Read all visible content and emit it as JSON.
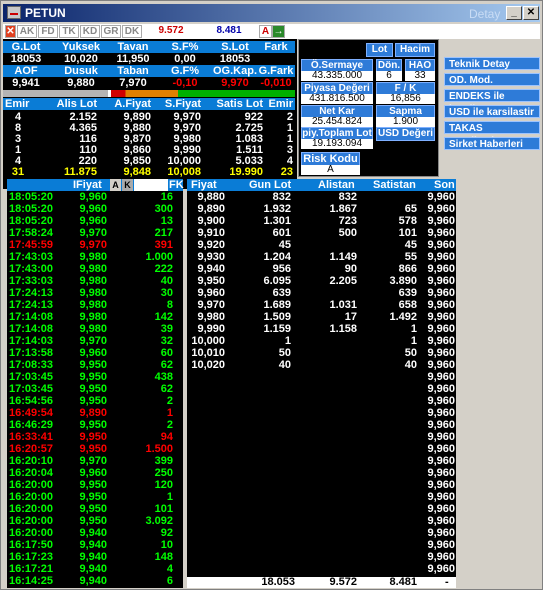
{
  "window": {
    "title": "PETUN",
    "title_faded": "Detay",
    "min": "_",
    "max": "□",
    "close": "✕"
  },
  "toolbar": {
    "buttons": [
      "AK",
      "FD",
      "TK",
      "KD",
      "GR",
      "DK"
    ],
    "price1": "9.572",
    "price2": "8.481",
    "a_label": "A",
    "go_label": "→"
  },
  "summary": {
    "row1_headers": [
      "G.Lot",
      "Yuksek",
      "Tavan",
      "S.F%",
      "S.Lot",
      "Fark"
    ],
    "row1_values": [
      "18053",
      "10,020",
      "11,950",
      "0,00",
      "18053",
      ""
    ],
    "row2_headers": [
      "AOF",
      "Dusuk",
      "Taban",
      "G.F%",
      "OG.Kap.",
      "G.Fark"
    ],
    "row2_values": [
      "9,941",
      "9,880",
      "7,970",
      "-0,10",
      "9,970",
      "-0,010"
    ]
  },
  "depth": {
    "headers": [
      "Emir",
      "Alis Lot",
      "A.Fiyat",
      "S.Fiyat",
      "Satis Lot",
      "Emir"
    ],
    "rows": [
      [
        "4",
        "2.152",
        "9,890",
        "9,970",
        "922",
        "2"
      ],
      [
        "8",
        "4.365",
        "9,880",
        "9,970",
        "2.725",
        "1"
      ],
      [
        "3",
        "116",
        "9,870",
        "9,980",
        "1.083",
        "1"
      ],
      [
        "1",
        "110",
        "9,860",
        "9,990",
        "1.511",
        "3"
      ],
      [
        "4",
        "220",
        "9,850",
        "10,000",
        "5.033",
        "4"
      ]
    ],
    "totals": [
      "31",
      "11.875",
      "9,848",
      "10,008",
      "19.990",
      "23"
    ]
  },
  "panel": {
    "lot": "Lot",
    "hacim": "Hacim",
    "o_sermaye": "Ö.Sermaye",
    "o_sermaye_val": "43.335.000",
    "don": "Dön.",
    "don_val": "6",
    "hao": "HAO",
    "hao_val": "33",
    "piyasa": "Piyasa Değeri",
    "piyasa_val": "431.816.500",
    "fk": "F / K",
    "fk_val": "16,856",
    "net_kar": "Net Kar",
    "net_kar_val": "25.454.824",
    "sapma": "Sapma",
    "sapma_val": "1.900",
    "toplam_lot": "piy.Toplam Lot",
    "toplam_lot_val": "19.193.094",
    "usd": "USD Değeri",
    "risk": "Risk Kodu",
    "risk_val": "A"
  },
  "menu": [
    "Teknik Detay",
    "OD. Mod.",
    "ENDEKS ile karsilas",
    "USD ile karsilastir",
    "TAKAS Karsilastirm",
    "Sirket Haberleri"
  ],
  "trades": {
    "header_fiyat": "IFiyat",
    "btn_a": "A",
    "btn_k": "K",
    "btn_fk": "FK",
    "rows": [
      [
        "18:05:20",
        "9,960",
        "16",
        "w"
      ],
      [
        "18:05:20",
        "9,960",
        "300",
        "w"
      ],
      [
        "18:05:20",
        "9,960",
        "13",
        "w"
      ],
      [
        "17:58:24",
        "9,970",
        "217",
        "w"
      ],
      [
        "17:45:59",
        "9,970",
        "391",
        "r"
      ],
      [
        "17:43:03",
        "9,980",
        "1.000",
        "w"
      ],
      [
        "17:43:00",
        "9,980",
        "222",
        "w"
      ],
      [
        "17:33:03",
        "9,980",
        "40",
        "w"
      ],
      [
        "17:24:13",
        "9,980",
        "30",
        "w"
      ],
      [
        "17:24:13",
        "9,980",
        "8",
        "w"
      ],
      [
        "17:14:08",
        "9,980",
        "142",
        "w"
      ],
      [
        "17:14:08",
        "9,980",
        "39",
        "w"
      ],
      [
        "17:14:03",
        "9,970",
        "32",
        "w"
      ],
      [
        "17:13:58",
        "9,960",
        "60",
        "w"
      ],
      [
        "17:08:33",
        "9,950",
        "62",
        "w"
      ],
      [
        "17:03:45",
        "9,950",
        "438",
        "w"
      ],
      [
        "17:03:45",
        "9,950",
        "62",
        "w"
      ],
      [
        "16:54:56",
        "9,950",
        "2",
        "w"
      ],
      [
        "16:49:54",
        "9,890",
        "1",
        "r"
      ],
      [
        "16:46:29",
        "9,950",
        "2",
        "w"
      ],
      [
        "16:33:41",
        "9,950",
        "94",
        "r"
      ],
      [
        "16:20:57",
        "9,950",
        "1.500",
        "r"
      ],
      [
        "16:20:10",
        "9,970",
        "399",
        "w"
      ],
      [
        "16:20:04",
        "9,960",
        "250",
        "w"
      ],
      [
        "16:20:00",
        "9,950",
        "120",
        "w"
      ],
      [
        "16:20:00",
        "9,950",
        "1",
        "w"
      ],
      [
        "16:20:00",
        "9,950",
        "101",
        "w"
      ],
      [
        "16:20:00",
        "9,950",
        "3.092",
        "w"
      ],
      [
        "16:20:00",
        "9,940",
        "92",
        "w"
      ],
      [
        "16:17:50",
        "9,940",
        "10",
        "w"
      ],
      [
        "16:17:23",
        "9,940",
        "148",
        "w"
      ],
      [
        "16:17:21",
        "9,940",
        "4",
        "w"
      ],
      [
        "16:14:25",
        "9,940",
        "6",
        "w"
      ]
    ]
  },
  "levels": {
    "headers": [
      "Fiyat",
      "Gun Lot",
      "Alistan",
      "Satistan",
      "Son"
    ],
    "rows": [
      [
        "9,880",
        "832",
        "832",
        "",
        "9,960"
      ],
      [
        "9,890",
        "1.932",
        "1.867",
        "65",
        "9,960"
      ],
      [
        "9,900",
        "1.301",
        "723",
        "578",
        "9,960"
      ],
      [
        "9,910",
        "601",
        "500",
        "101",
        "9,960"
      ],
      [
        "9,920",
        "45",
        "",
        "45",
        "9,960"
      ],
      [
        "9,930",
        "1.204",
        "1.149",
        "55",
        "9,960"
      ],
      [
        "9,940",
        "956",
        "90",
        "866",
        "9,960"
      ],
      [
        "9,950",
        "6.095",
        "2.205",
        "3.890",
        "9,960"
      ],
      [
        "9,960",
        "639",
        "",
        "639",
        "9,960"
      ],
      [
        "9,970",
        "1.689",
        "1.031",
        "658",
        "9,960"
      ],
      [
        "9,980",
        "1.509",
        "17",
        "1.492",
        "9,960"
      ],
      [
        "9,990",
        "1.159",
        "1.158",
        "1",
        "9,960"
      ],
      [
        "10,000",
        "1",
        "",
        "1",
        "9,960"
      ],
      [
        "10,010",
        "50",
        "",
        "50",
        "9,960"
      ],
      [
        "10,020",
        "40",
        "",
        "40",
        "9,960"
      ]
    ],
    "son_tail": [
      "9,960",
      "9,960",
      "9,960",
      "9,960",
      "9,960",
      "9,960",
      "9,960",
      "9,960",
      "9,960",
      "9,960",
      "9,960",
      "9,960",
      "9,960",
      "9,960",
      "9,960",
      "9,960",
      "9,960"
    ],
    "footer": [
      "18.053",
      "9.572",
      "8.481",
      "-"
    ]
  }
}
